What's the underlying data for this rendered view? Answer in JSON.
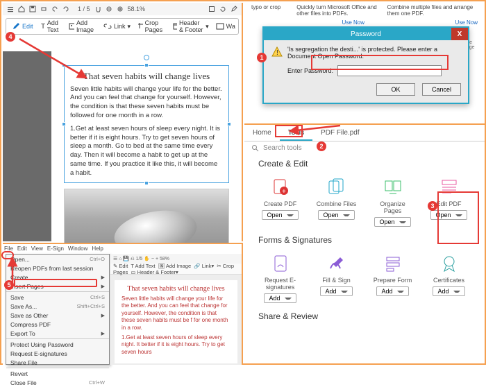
{
  "tl": {
    "zoom": "58.1%",
    "page_indicator": "1 / 5",
    "toolbar": {
      "edit": "Edit",
      "add_text": "Add Text",
      "add_image": "Add Image",
      "link": "Link",
      "crop_pages": "Crop Pages",
      "header_footer": "Header & Footer",
      "watermark": "Wa"
    },
    "heading": "That seven habits will change lives",
    "para1": "Seven little habits will change your life for the better. And you can feel that change for yourself. However, the condition is that these seven habits must be followed for one month in a row.",
    "para2": "1.Get at least seven hours of sleep every night. It is better if it is eight hours. Try to get seven hours of sleep a month. Go to bed at the same time every day. Then it will become a habit to get up at the same time. If you practice it like this, it will become a habit."
  },
  "tr": {
    "bg": {
      "l1": "typo or crop",
      "l2": "Quickly turn Microsoft Office and other files into PDFs.",
      "l3": "Combine multiple files and arrange them one PDF.",
      "use_now": "Use Now"
    },
    "dialog": {
      "title": "Password",
      "message": "'Is segregation the desti...' is protected. Please enter a Document Open Password.",
      "label": "Enter Password:",
      "ok": "OK",
      "cancel": "Cancel"
    },
    "rightbadge": "rate page"
  },
  "br": {
    "tabs": {
      "home": "Home",
      "tools": "Tools",
      "file": "PDF File.pdf"
    },
    "search_placeholder": "Search tools",
    "section1": {
      "title": "Create & Edit",
      "tools": [
        {
          "name": "Create PDF",
          "btn": "Open"
        },
        {
          "name": "Combine Files",
          "btn": "Open"
        },
        {
          "name": "Organize Pages",
          "btn": "Open"
        },
        {
          "name": "Edit PDF",
          "btn": "Open"
        }
      ]
    },
    "section2": {
      "title": "Forms & Signatures",
      "tools": [
        {
          "name": "Request E-signatures",
          "btn": "Add"
        },
        {
          "name": "Fill & Sign",
          "btn": "Add"
        },
        {
          "name": "Prepare Form",
          "btn": "Add"
        },
        {
          "name": "Certificates",
          "btn": "Add"
        }
      ]
    },
    "section3": {
      "title": "Share & Review"
    }
  },
  "bl": {
    "menubar": [
      "File",
      "Edit",
      "View",
      "E-Sign",
      "Window",
      "Help"
    ],
    "menu": {
      "open": {
        "label": "Open...",
        "sc": "Ctrl+O"
      },
      "reopen": "Reopen PDFs from last session",
      "create": "Create",
      "insert": "Insert Pages",
      "save": {
        "label": "Save",
        "sc": "Ctrl+S"
      },
      "saveas": {
        "label": "Save As...",
        "sc": "Shift+Ctrl+S"
      },
      "saveother": "Save as Other",
      "compress": "Compress PDF",
      "export": "Export To",
      "protect": "Protect Using Password",
      "requestsig": "Request E-signatures",
      "sharefile": "Share File",
      "revert": "Revert",
      "closefile": {
        "label": "Close File",
        "sc": "Ctrl+W"
      }
    },
    "doc": {
      "heading": "That seven habits will change lives",
      "para1": "Seven little habits will change your life for the better. And you can feel that change for yourself. However, the condition is that these seven habits must be f for one month in a row.",
      "para2": "1.Get at least seven hours of sleep every night. It better if it is eight hours. Try to get seven hours"
    }
  },
  "markers": {
    "m1": "1",
    "m2": "2",
    "m3": "3",
    "m4": "4",
    "m5": "5"
  }
}
